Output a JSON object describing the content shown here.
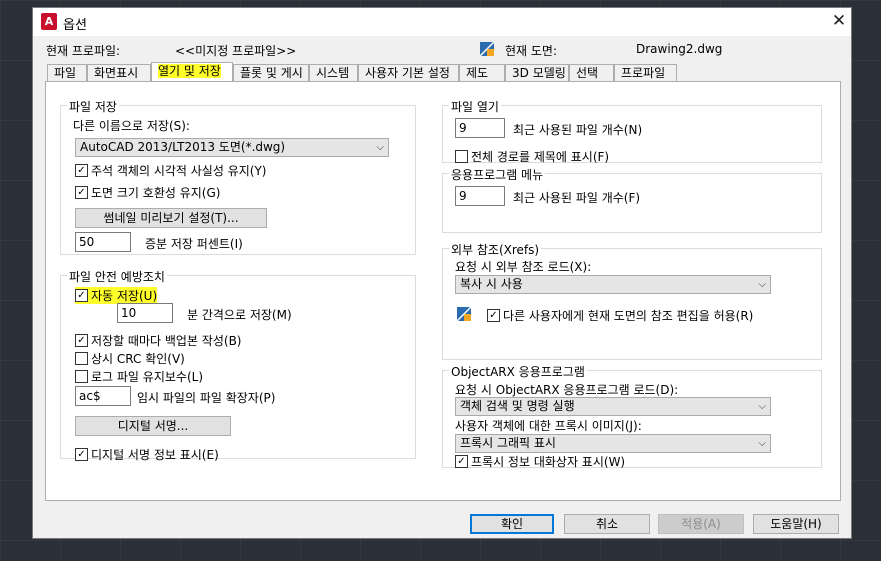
{
  "window": {
    "title": "옵션",
    "app_icon_letter": "A"
  },
  "header": {
    "profile_label": "현재 프로파일:",
    "profile_value": "<<미지정 프로파일>>",
    "drawing_label": "현재 도면:",
    "drawing_value": "Drawing2.dwg"
  },
  "tabs": [
    {
      "label": "파일"
    },
    {
      "label": "화면표시"
    },
    {
      "label": "열기 및 저장"
    },
    {
      "label": "플롯 및 게시"
    },
    {
      "label": "시스템"
    },
    {
      "label": "사용자 기본 설정"
    },
    {
      "label": "제도"
    },
    {
      "label": "3D 모델링"
    },
    {
      "label": "선택"
    },
    {
      "label": "프로파일"
    }
  ],
  "file_save": {
    "title": "파일 저장",
    "save_as_label": "다른 이름으로 저장(S):",
    "save_as_value": "AutoCAD 2013/LT2013 도면(*.dwg)",
    "annot_visual": "주석 객체의 시각적 사실성 유지(Y)",
    "annot_visual_checked": true,
    "drawing_size": "도면 크기 호환성 유지(G)",
    "drawing_size_checked": true,
    "thumbnail_button": "썸네일 미리보기 설정(T)...",
    "incremental_value": "50",
    "incremental_label": "증분 저장 퍼센트(I)"
  },
  "file_safety": {
    "title": "파일 안전 예방조치",
    "autosave": "자동 저장(U)",
    "autosave_checked": true,
    "minutes_value": "10",
    "minutes_label": "분 간격으로 저장(M)",
    "backup": "저장할 때마다 백업본 작성(B)",
    "backup_checked": true,
    "crc": "상시 CRC 확인(V)",
    "crc_checked": false,
    "log": "로그 파일 유지보수(L)",
    "log_checked": false,
    "temp_ext_value": "ac$",
    "temp_ext_label": "임시 파일의 파일 확장자(P)",
    "digital_sig_button": "디지털 서명...",
    "show_sig": "디지털 서명 정보 표시(E)",
    "show_sig_checked": true
  },
  "file_open": {
    "title": "파일 열기",
    "recent_value": "9",
    "recent_label": "최근 사용된 파일 개수(N)",
    "full_path": "전체 경로를 제목에 표시(F)",
    "full_path_checked": false
  },
  "app_menu": {
    "title": "응용프로그램 메뉴",
    "recent_value": "9",
    "recent_label": "최근 사용된 파일 개수(F)"
  },
  "xrefs": {
    "title": "외부 참조(Xrefs)",
    "demand_load_label": "요청 시 외부 참조 로드(X):",
    "demand_load_value": "복사 시 사용",
    "allow_edit": "다른 사용자에게 현재 도면의 참조 편집을 허용(R)",
    "allow_edit_checked": true
  },
  "objectarx": {
    "title": "ObjectARX 응용프로그램",
    "demand_load_label": "요청 시 ObjectARX 응용프로그램 로드(D):",
    "demand_load_value": "객체 검색 및 명령 실행",
    "proxy_label": "사용자 객체에 대한 프록시 이미지(J):",
    "proxy_value": "프록시 그래픽 표시",
    "proxy_info": "프록시 정보 대화상자 표시(W)",
    "proxy_info_checked": true
  },
  "buttons": {
    "ok": "확인",
    "cancel": "취소",
    "apply": "적용(A)",
    "help": "도움말(H)"
  }
}
